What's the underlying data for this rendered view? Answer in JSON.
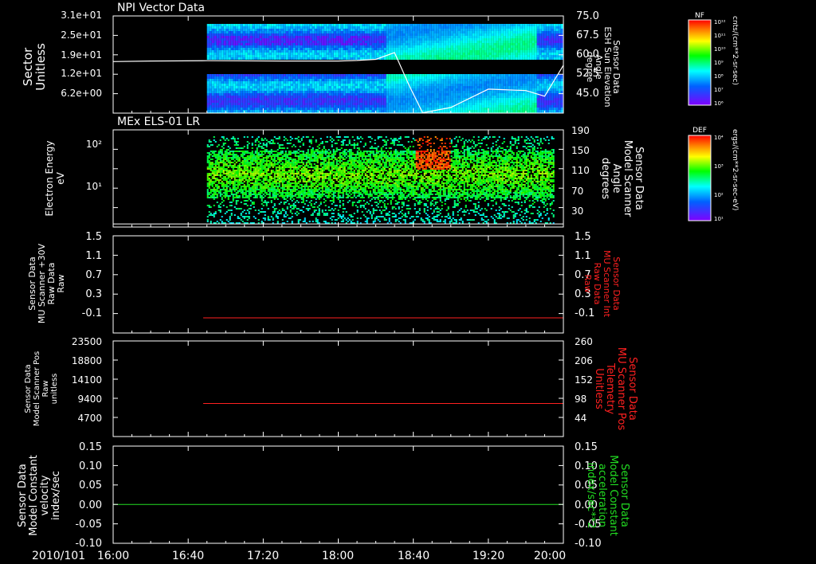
{
  "colors": {
    "background": "#000000",
    "axis": "#ffffff",
    "red_trace": "#ff2020",
    "green_trace": "#22dd22"
  },
  "x_axis": {
    "date_label": "2010/101",
    "start": "16:00",
    "end": "20:00",
    "tick_labels": [
      "16:00",
      "16:40",
      "17:20",
      "18:00",
      "18:40",
      "19:20",
      "20:00"
    ]
  },
  "panels": [
    {
      "title": "NPI Vector Data",
      "left_label": [
        "Sector",
        "Unitless"
      ],
      "left_ticks": [
        "3.1e+01",
        "2.5e+01",
        "1.9e+01",
        "1.2e+01",
        "6.2e+00"
      ],
      "right_label": [
        "Sensor Data",
        "ESH Sun Elevation",
        "Angle",
        "degree"
      ],
      "right_ticks": [
        "75.0",
        "67.5",
        "60.0",
        "52.5",
        "45.0"
      ],
      "colorbar": {
        "label": "NF",
        "ticks": [
          "10¹²",
          "10¹¹",
          "10¹⁰",
          "10⁹",
          "10⁸",
          "10⁷",
          "10⁶"
        ],
        "units": "cnts/(cm**2-sr-sec)"
      }
    },
    {
      "title": "MEx ELS-01 LR",
      "left_label": [
        "Electron Energy",
        "eV"
      ],
      "left_ticks": [
        "10²",
        "10¹"
      ],
      "right_label": [
        "Sensor Data",
        "Model Scanner",
        "Angle",
        "degrees"
      ],
      "right_ticks": [
        "190",
        "150",
        "110",
        "70",
        "30"
      ],
      "colorbar": {
        "label": "DEF",
        "ticks": [
          "10⁴",
          "10³",
          "10²",
          "10¹"
        ],
        "units": "ergs/(cm**2-sr-sec-eV)"
      }
    },
    {
      "left_label": [
        "Sensor Data",
        "MU Scanner +30V",
        "Raw Data",
        "Raw"
      ],
      "left_ticks": [
        "1.5",
        "1.1",
        "0.7",
        "0.3",
        "-0.1"
      ],
      "right_label": [
        "Sensor Data",
        "MU Scanner Int",
        "Raw Data",
        "Raw"
      ],
      "right_ticks": [
        "1.5",
        "1.1",
        "0.7",
        "0.3",
        "-0.1"
      ]
    },
    {
      "left_label": [
        "Sensor Data",
        "Model Scanner Pos",
        "Raw",
        "unitless"
      ],
      "left_ticks": [
        "23500",
        "18800",
        "14100",
        "9400",
        "4700"
      ],
      "right_label": [
        "Sensor Data",
        "MU Scanner Pos",
        "Telemetry",
        "Unitless"
      ],
      "right_ticks": [
        "260",
        "206",
        "152",
        "98",
        "44"
      ]
    },
    {
      "left_label": [
        "Sensor Data",
        "Model Constant",
        "velocity",
        "index/sec"
      ],
      "left_ticks": [
        "0.15",
        "0.10",
        "0.05",
        "0.00",
        "-0.05",
        "-0.10"
      ],
      "right_label": [
        "Sensor Data",
        "Model Constant",
        "acceleration",
        "index/sec**2"
      ],
      "right_ticks": [
        "0.15",
        "0.10",
        "0.05",
        "0.00",
        "-0.05",
        "-0.10"
      ]
    }
  ],
  "chart_data": [
    {
      "type": "heatmap",
      "title": "NPI Vector Data",
      "xlabel": "",
      "ylabel": "Sector Unitless",
      "ylim": [
        0,
        31
      ],
      "data_start": "16:50",
      "data_end": "20:00",
      "series": [
        {
          "name": "Sensor Data ESH Sun Elevation Angle",
          "axis": "right",
          "ylim": [
            40.5,
            75
          ],
          "x": [
            "16:00",
            "16:20",
            "16:50",
            "17:30",
            "18:00",
            "18:10",
            "18:20",
            "18:30",
            "18:38",
            "18:45",
            "19:00",
            "19:20",
            "19:40",
            "19:50",
            "20:00"
          ],
          "values": [
            58.8,
            59.0,
            59.1,
            59.0,
            59.0,
            59.2,
            59.6,
            62.0,
            50.0,
            40.6,
            42.5,
            49.0,
            48.5,
            46.5,
            57.5
          ]
        }
      ]
    },
    {
      "type": "heatmap",
      "title": "MEx ELS-01 LR",
      "xlabel": "",
      "ylabel": "Electron Energy eV",
      "log_y": true,
      "ylim": [
        1,
        200
      ],
      "data_start": "16:50",
      "data_end": "19:55",
      "series": [
        {
          "name": "Sensor Data Model Scanner Angle",
          "axis": "right",
          "ylim": [
            0,
            190
          ],
          "x": [
            "16:00",
            "20:00"
          ],
          "values": [
            6,
            6
          ]
        }
      ]
    },
    {
      "type": "line",
      "xlabel": "",
      "ylabel": "Sensor Data MU Scanner +30V Raw Data Raw",
      "ylim": [
        -0.3,
        1.5
      ],
      "series": [
        {
          "name": "Sensor Data MU Scanner Int Raw Data Raw",
          "axis": "right",
          "ylim": [
            -0.3,
            1.5
          ],
          "x": [
            "16:48",
            "20:00"
          ],
          "values": [
            -0.02,
            -0.02
          ]
        }
      ]
    },
    {
      "type": "line",
      "xlabel": "",
      "ylabel": "Sensor Data Model Scanner Pos Raw unitless",
      "ylim": [
        0,
        23500
      ],
      "series": [
        {
          "name": "Sensor Data MU Scanner Pos Telemetry Unitless",
          "axis": "right",
          "ylim": [
            0,
            260
          ],
          "x": [
            "16:48",
            "20:00"
          ],
          "values": [
            90,
            90
          ]
        }
      ]
    },
    {
      "type": "line",
      "xlabel": "",
      "ylabel": "Sensor Data Model Constant velocity index/sec",
      "ylim": [
        -0.1,
        0.15
      ],
      "series": [
        {
          "name": "Sensor Data Model Constant velocity index/sec",
          "axis": "left",
          "x": [
            "16:00",
            "20:00"
          ],
          "values": [
            0,
            0
          ]
        }
      ]
    }
  ]
}
